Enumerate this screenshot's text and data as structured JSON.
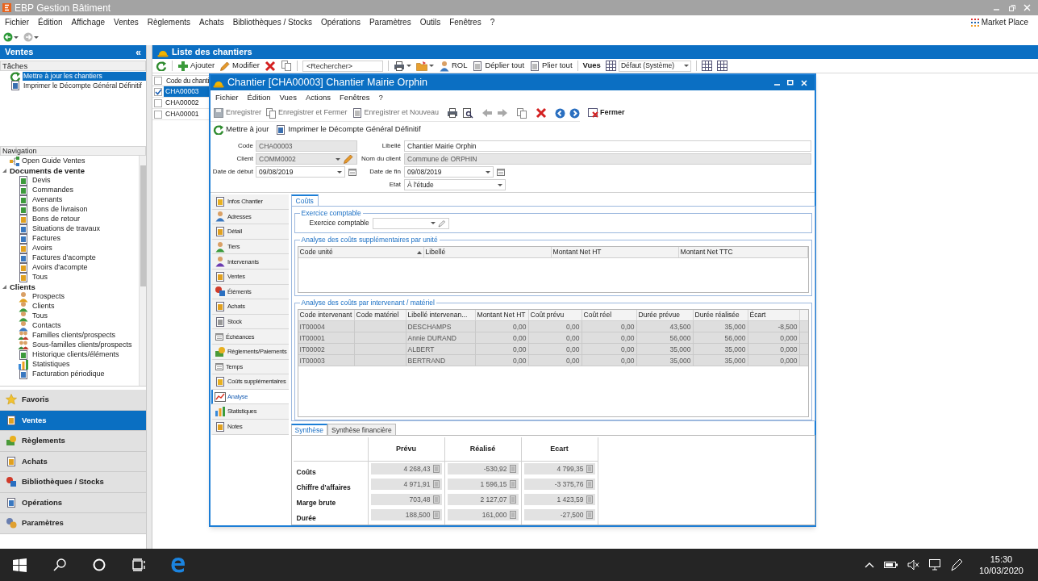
{
  "app": {
    "title": "EBP Gestion Bâtiment",
    "menu": [
      "Fichier",
      "Édition",
      "Affichage",
      "Ventes",
      "Règlements",
      "Achats",
      "Bibliothèques / Stocks",
      "Opérations",
      "Paramètres",
      "Outils",
      "Fenêtres",
      "?"
    ],
    "market_place": "Market Place"
  },
  "sidebar": {
    "title": "Ventes",
    "collapse_glyph": "«",
    "tasks_header": "Tâches",
    "tasks": [
      {
        "label": "Mettre à jour les chantiers",
        "selected": true
      },
      {
        "label": "Imprimer le Décompte Général Définitif",
        "selected": false
      }
    ],
    "nav_header": "Navigation",
    "tree": [
      {
        "label": "Open Guide Ventes"
      },
      {
        "label": "Documents de vente",
        "expanded": true,
        "children": [
          {
            "label": "Devis"
          },
          {
            "label": "Commandes"
          },
          {
            "label": "Avenants"
          },
          {
            "label": "Bons de livraison"
          },
          {
            "label": "Bons de retour"
          },
          {
            "label": "Situations de travaux"
          },
          {
            "label": "Factures"
          },
          {
            "label": "Avoirs"
          },
          {
            "label": "Factures d'acompte"
          },
          {
            "label": "Avoirs d'acompte"
          },
          {
            "label": "Tous"
          }
        ]
      },
      {
        "label": "Clients",
        "expanded": true,
        "children": [
          {
            "label": "Prospects"
          },
          {
            "label": "Clients"
          },
          {
            "label": "Tous"
          },
          {
            "label": "Contacts"
          },
          {
            "label": "Familles clients/prospects"
          },
          {
            "label": "Sous-familles clients/prospects"
          },
          {
            "label": "Historique clients/éléments"
          },
          {
            "label": "Statistiques"
          },
          {
            "label": "Facturation périodique"
          }
        ]
      }
    ],
    "modules": [
      {
        "label": "Favoris",
        "selected": false
      },
      {
        "label": "Ventes",
        "selected": true
      },
      {
        "label": "Règlements",
        "selected": false
      },
      {
        "label": "Achats",
        "selected": false
      },
      {
        "label": "Bibliothèques / Stocks",
        "selected": false
      },
      {
        "label": "Opérations",
        "selected": false
      },
      {
        "label": "Paramètres",
        "selected": false
      }
    ]
  },
  "list": {
    "title": "Liste des chantiers",
    "toolbar": {
      "add": "Ajouter",
      "edit": "Modifier",
      "search_placeholder": "<Rechercher>",
      "rol": "ROL",
      "expand_all": "Déplier tout",
      "collapse_all": "Plier tout",
      "views_label": "Vues",
      "view": "Défaut (Système)"
    },
    "column": "Code du chanti",
    "all_checked": false,
    "rows": [
      {
        "code": "CHA00003",
        "checked": true,
        "selected": true
      },
      {
        "code": "CHA00002",
        "checked": false,
        "selected": false
      },
      {
        "code": "CHA00001",
        "checked": false,
        "selected": false
      }
    ]
  },
  "dialog": {
    "title": "Chantier [CHA00003] Chantier Mairie Orphin",
    "menu": [
      "Fichier",
      "Édition",
      "Vues",
      "Actions",
      "Fenêtres",
      "?"
    ],
    "toolbar": [
      {
        "label": "Enregistrer",
        "disabled": true
      },
      {
        "label": "Enregistrer et Fermer",
        "disabled": true
      },
      {
        "label": "Enregistrer et Nouveau",
        "disabled": true
      }
    ],
    "close_label": "Fermer",
    "actions": [
      "Mettre à jour",
      "Imprimer le Décompte Général Définitif"
    ],
    "fields_left": [
      {
        "label": "Code",
        "value": "CHA00003",
        "kind": "text",
        "disabled": true
      },
      {
        "label": "Client",
        "value": "COMM0002",
        "kind": "combo",
        "disabled": true
      },
      {
        "label": "Date de début",
        "value": "09/08/2019",
        "kind": "date",
        "disabled": false
      }
    ],
    "fields_right": [
      {
        "label": "Libellé",
        "value": "Chantier Mairie Orphin",
        "kind": "text",
        "disabled": false
      },
      {
        "label": "Nom du client",
        "value": "Commune de ORPHIN",
        "kind": "text",
        "disabled": true
      },
      {
        "label": "Date de fin",
        "value": "09/08/2019",
        "kind": "date",
        "disabled": false
      },
      {
        "label": "Etat",
        "value": "À l'étude",
        "kind": "combo",
        "disabled": false
      }
    ],
    "side_tabs": [
      {
        "label": "Infos Chantier",
        "selected": false
      },
      {
        "label": "Adresses",
        "selected": false
      },
      {
        "label": "Détail",
        "selected": false
      },
      {
        "label": "Tiers",
        "selected": false
      },
      {
        "label": "Intervenants",
        "selected": false
      },
      {
        "label": "Ventes",
        "selected": false
      },
      {
        "label": "Éléments",
        "selected": false
      },
      {
        "label": "Achats",
        "selected": false
      },
      {
        "label": "Stock",
        "selected": false
      },
      {
        "label": "Échéances",
        "selected": false
      },
      {
        "label": "Règlements/Paiements",
        "selected": false
      },
      {
        "label": "Temps",
        "selected": false
      },
      {
        "label": "Coûts supplémentaires",
        "selected": false
      },
      {
        "label": "Analyse",
        "selected": true
      },
      {
        "label": "Statistiques",
        "selected": false
      },
      {
        "label": "Notes",
        "selected": false
      }
    ],
    "content_tab": "Coûts",
    "exercise_group": {
      "title": "Exercice comptable",
      "label": "Exercice comptable"
    },
    "unit_group": {
      "title": "Analyse des coûts supplémentaires par unité",
      "columns": [
        "Code unité",
        "Libellé",
        "Montant Net HT",
        "Montant Net TTC"
      ]
    },
    "worker_group": {
      "title": "Analyse des coûts par intervenant / matériel",
      "columns": [
        "Code intervenant",
        "Code matériel",
        "Libellé intervenan...",
        "Montant Net HT",
        "Coût prévu",
        "Coût réel",
        "Durée prévue",
        "Durée réalisée",
        "Écart"
      ],
      "rows": [
        [
          "IT00004",
          "",
          "DESCHAMPS",
          "0,00",
          "0,00",
          "0,00",
          "43,500",
          "35,000",
          "-8,500"
        ],
        [
          "IT00001",
          "",
          "Annie DURAND",
          "0,00",
          "0,00",
          "0,00",
          "56,000",
          "56,000",
          "0,000"
        ],
        [
          "IT00002",
          "",
          "ALBERT",
          "0,00",
          "0,00",
          "0,00",
          "35,000",
          "35,000",
          "0,000"
        ],
        [
          "IT00003",
          "",
          "BERTRAND",
          "0,00",
          "0,00",
          "0,00",
          "35,000",
          "35,000",
          "0,000"
        ]
      ]
    },
    "summary_tabs": [
      {
        "label": "Synthèse",
        "selected": true
      },
      {
        "label": "Synthèse financière",
        "selected": false
      }
    ],
    "summary": {
      "columns": [
        "Prévu",
        "Réalisé",
        "Ecart"
      ],
      "rows": [
        {
          "label": "Coûts",
          "values": [
            "4 268,43",
            "-530,92",
            "4 799,35"
          ]
        },
        {
          "label": "Chiffre d'affaires",
          "values": [
            "4 971,91",
            "1 596,15",
            "-3 375,76"
          ]
        },
        {
          "label": "Marge brute",
          "values": [
            "703,48",
            "2 127,07",
            "1 423,59"
          ]
        },
        {
          "label": "Durée",
          "values": [
            "188,500",
            "161,000",
            "-27,500"
          ]
        }
      ]
    }
  },
  "taskbar": {
    "time": "15:30",
    "date": "10/03/2020"
  }
}
